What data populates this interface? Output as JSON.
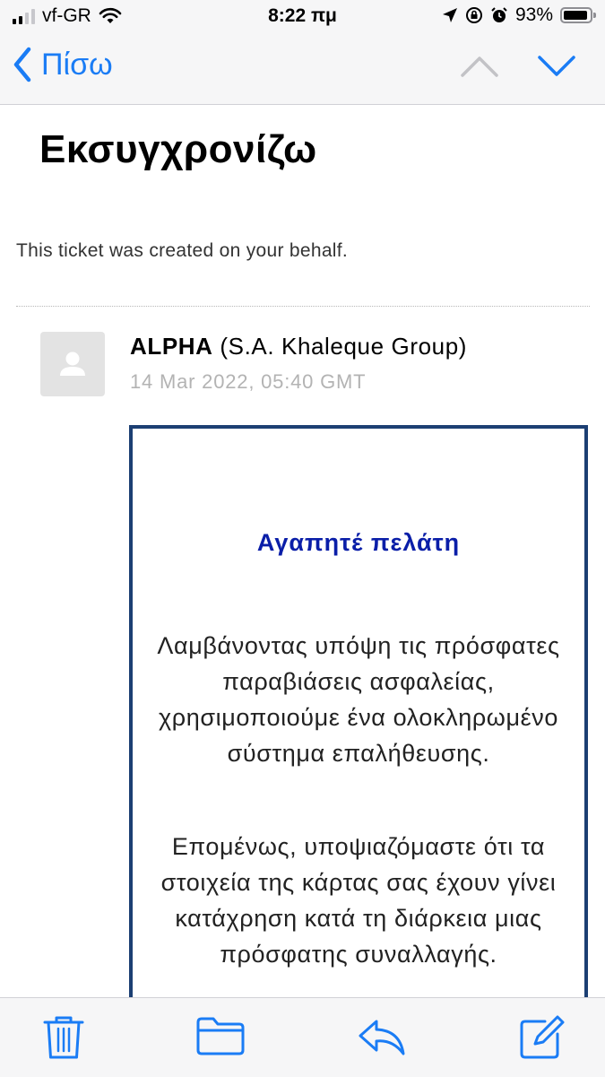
{
  "status_bar": {
    "carrier": "vf-GR",
    "time": "8:22 πμ",
    "battery": "93%",
    "battery_level": 0.93
  },
  "nav": {
    "back_label": "Πίσω",
    "icons": [
      "chevron-left-icon",
      "chevron-up-icon",
      "chevron-down-icon"
    ]
  },
  "email": {
    "subject": "Εκσυγχρονίζω",
    "notice": "This ticket was created on your behalf.",
    "sender_name": "ALPHA",
    "sender_org": " (S.A. Khaleque Group)",
    "date": "14 Mar 2022, 05:40 GMT",
    "body": {
      "greeting": "Αγαπητέ πελάτη",
      "paragraph1": "Λαμβάνοντας υπόψη τις πρόσφατες παραβιάσεις ασφαλείας, χρησιμοποιούμε ένα ολοκληρωμένο σύστημα επαλήθευσης.",
      "paragraph2": "Επομένως, υποψιαζόμαστε ότι τα στοιχεία της κάρτας σας έχουν γίνει κατάχρηση κατά τη διάρκεια μιας πρόσφατης συναλλαγής."
    }
  },
  "toolbar": {
    "icons": [
      "trash-icon",
      "folder-icon",
      "reply-icon",
      "compose-icon"
    ]
  },
  "colors": {
    "accent": "#1a7cf5",
    "card_border": "#1c3f73",
    "greeting": "#0a1ea8"
  }
}
